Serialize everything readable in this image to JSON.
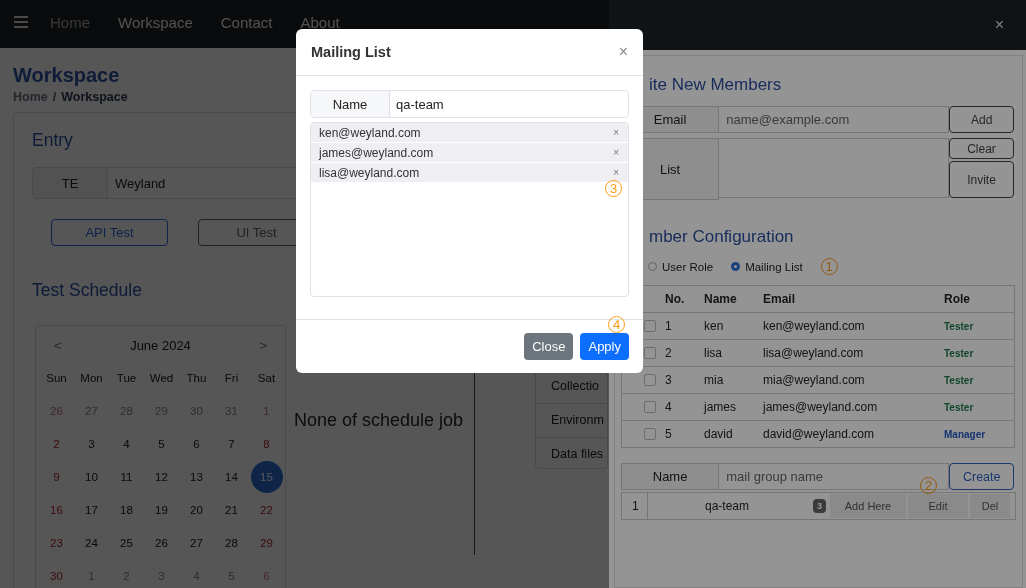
{
  "navbar": {
    "links": [
      {
        "label": "Home",
        "disabled": true
      },
      {
        "label": "Workspace",
        "disabled": false
      },
      {
        "label": "Contact",
        "disabled": false
      },
      {
        "label": "About",
        "disabled": false
      }
    ]
  },
  "page": {
    "title": "Workspace",
    "breadcrumb": [
      "Home",
      "Workspace"
    ],
    "breadcrumb_separator": "/"
  },
  "entry": {
    "title": "Entry",
    "team_label": "TE",
    "team_value": "Weyland",
    "buttons": [
      {
        "label": "API Test",
        "kind": "primary"
      },
      {
        "label": "UI Test",
        "kind": "secondary"
      }
    ]
  },
  "schedule": {
    "title": "Test Schedule",
    "empty_text": "None of schedule job",
    "calendar": {
      "prev": "<",
      "month": "June 2024",
      "next": ">",
      "weekdays": [
        "Sun",
        "Mon",
        "Tue",
        "Wed",
        "Thu",
        "Fri",
        "Sat"
      ],
      "weeks": [
        [
          {
            "day": "26",
            "muted": true,
            "selected": false
          },
          {
            "day": "27",
            "muted": true,
            "selected": false
          },
          {
            "day": "28",
            "muted": true,
            "selected": false
          },
          {
            "day": "29",
            "muted": true,
            "selected": false
          },
          {
            "day": "30",
            "muted": true,
            "selected": false
          },
          {
            "day": "31",
            "muted": true,
            "selected": false
          },
          {
            "day": "1",
            "muted": true,
            "selected": false
          }
        ],
        [
          {
            "day": "2",
            "muted": false,
            "selected": false
          },
          {
            "day": "3",
            "muted": false,
            "selected": false
          },
          {
            "day": "4",
            "muted": false,
            "selected": false
          },
          {
            "day": "5",
            "muted": false,
            "selected": false
          },
          {
            "day": "6",
            "muted": false,
            "selected": false
          },
          {
            "day": "7",
            "muted": false,
            "selected": false
          },
          {
            "day": "8",
            "muted": false,
            "selected": false
          }
        ],
        [
          {
            "day": "9",
            "muted": false,
            "selected": false
          },
          {
            "day": "10",
            "muted": false,
            "selected": false
          },
          {
            "day": "11",
            "muted": false,
            "selected": false
          },
          {
            "day": "12",
            "muted": false,
            "selected": false
          },
          {
            "day": "13",
            "muted": false,
            "selected": false
          },
          {
            "day": "14",
            "muted": false,
            "selected": false
          },
          {
            "day": "15",
            "muted": false,
            "selected": true
          }
        ],
        [
          {
            "day": "16",
            "muted": false,
            "selected": false
          },
          {
            "day": "17",
            "muted": false,
            "selected": false
          },
          {
            "day": "18",
            "muted": false,
            "selected": false
          },
          {
            "day": "19",
            "muted": false,
            "selected": false
          },
          {
            "day": "20",
            "muted": false,
            "selected": false
          },
          {
            "day": "21",
            "muted": false,
            "selected": false
          },
          {
            "day": "22",
            "muted": false,
            "selected": false
          }
        ],
        [
          {
            "day": "23",
            "muted": false,
            "selected": false
          },
          {
            "day": "24",
            "muted": false,
            "selected": false
          },
          {
            "day": "25",
            "muted": false,
            "selected": false
          },
          {
            "day": "26",
            "muted": false,
            "selected": false
          },
          {
            "day": "27",
            "muted": false,
            "selected": false
          },
          {
            "day": "28",
            "muted": false,
            "selected": false
          },
          {
            "day": "29",
            "muted": false,
            "selected": false
          }
        ],
        [
          {
            "day": "30",
            "muted": false,
            "selected": false
          },
          {
            "day": "1",
            "muted": true,
            "selected": false
          },
          {
            "day": "2",
            "muted": true,
            "selected": false
          },
          {
            "day": "3",
            "muted": true,
            "selected": false
          },
          {
            "day": "4",
            "muted": true,
            "selected": false
          },
          {
            "day": "5",
            "muted": true,
            "selected": false
          },
          {
            "day": "6",
            "muted": true,
            "selected": false
          }
        ]
      ]
    }
  },
  "resources": {
    "items": [
      "Collectio",
      "Environm",
      "Data files"
    ]
  },
  "drawer": {
    "close": "×",
    "invite": {
      "title": "ite New Members",
      "email_label": "Email",
      "email_placeholder": "name@example.com",
      "add": "Add",
      "list_label": "List",
      "clear": "Clear",
      "invite": "Invite"
    },
    "config": {
      "title": "mber Configuration",
      "modes": [
        {
          "label": "User Role",
          "selected": false
        },
        {
          "label": "Mailing List",
          "selected": true
        }
      ],
      "mode_marker": "1",
      "table": {
        "columns": [
          "No.",
          "Name",
          "Email",
          "Role"
        ],
        "rows": [
          {
            "checked": false,
            "no": "1",
            "name": "ken",
            "email": "ken@weyland.com",
            "role": "Tester",
            "kind": "tester"
          },
          {
            "checked": false,
            "no": "2",
            "name": "lisa",
            "email": "lisa@weyland.com",
            "role": "Tester",
            "kind": "tester"
          },
          {
            "checked": false,
            "no": "3",
            "name": "mia",
            "email": "mia@weyland.com",
            "role": "Tester",
            "kind": "tester"
          },
          {
            "checked": false,
            "no": "4",
            "name": "james",
            "email": "james@weyland.com",
            "role": "Tester",
            "kind": "tester"
          },
          {
            "checked": false,
            "no": "5",
            "name": "david",
            "email": "david@weyland.com",
            "role": "Manager",
            "kind": "manager"
          }
        ]
      },
      "group_form": {
        "label": "Name",
        "placeholder": "mail group name",
        "create": "Create"
      },
      "groups": [
        {
          "no": "1",
          "name": "qa-team",
          "count": "3",
          "actions": [
            "Add Here",
            "Edit",
            "Del"
          ]
        }
      ],
      "edit_marker": "2"
    }
  },
  "modal": {
    "title": "Mailing List",
    "close": "×",
    "name_label": "Name",
    "name_value": "qa-team",
    "members": [
      {
        "email": "ken@weyland.com",
        "remove": "×"
      },
      {
        "email": "james@weyland.com",
        "remove": "×"
      },
      {
        "email": "lisa@weyland.com",
        "remove": "×"
      }
    ],
    "members_marker": "3",
    "footer_marker": "4",
    "buttons": [
      {
        "label": "Close",
        "kind": "secondary"
      },
      {
        "label": "Apply",
        "kind": "primary"
      }
    ]
  }
}
